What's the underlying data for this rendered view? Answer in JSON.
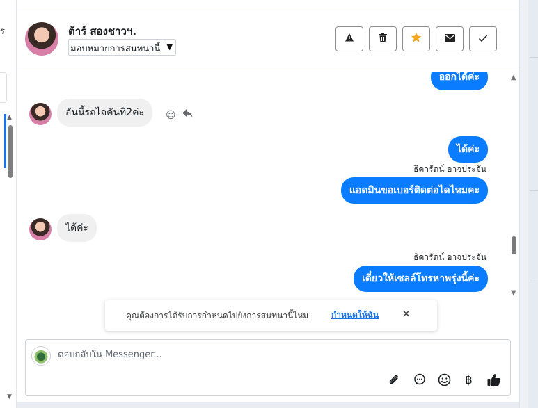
{
  "sidebar": {
    "glyph": "ร"
  },
  "header": {
    "contact_name": "ต้าร์ สองชาวฯ.",
    "assign_label": "มอบหมายการสนทนานี้",
    "actions": [
      {
        "name": "report-button",
        "icon": "warning-icon",
        "glyph": "⚠"
      },
      {
        "name": "delete-button",
        "icon": "trash-icon",
        "glyph": "🗑"
      },
      {
        "name": "star-button",
        "icon": "star-icon",
        "glyph": "★",
        "color": "#f5a623"
      },
      {
        "name": "mark-unread-button",
        "icon": "envelope-icon",
        "glyph": "✉"
      },
      {
        "name": "mark-done-button",
        "icon": "check-icon",
        "glyph": "✓"
      }
    ]
  },
  "messages": {
    "m1": {
      "text": "ออกได้ค่ะ"
    },
    "m2": {
      "text": "อันนี้รถไถคันที่2ค่ะ"
    },
    "m3": {
      "text": "ได้ค่ะ"
    },
    "m4": {
      "sender": "ธิดารัตน์ อาจประจัน",
      "text": "แอดมินขอเบอร์ติดต่อไดไหมคะ"
    },
    "m5": {
      "text": "ได้ค่ะ"
    },
    "m6": {
      "sender": "ธิดารัตน์ อาจประจัน",
      "text": "เดี๋ยวให้เซลล์โทรหาพรุ่งนี้ค่ะ"
    }
  },
  "toast": {
    "message": "คุณต้องการได้รับการกำหนดไปยังการสนทนานี้ไหม",
    "action": "กำหนดให้ฉัน"
  },
  "composer": {
    "placeholder": "ตอบกลับใน Messenger..."
  },
  "colors": {
    "accent": "#0a7cff",
    "link": "#1a73e8"
  }
}
